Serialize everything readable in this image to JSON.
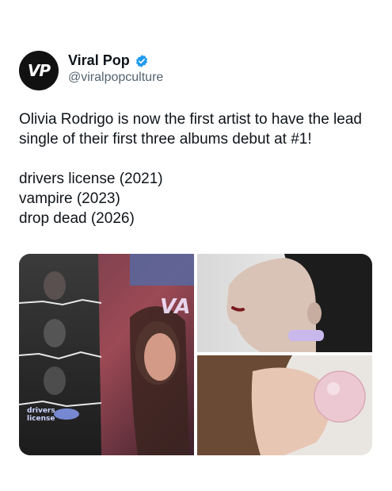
{
  "author": {
    "avatar_text": "VP",
    "display_name": "Viral Pop",
    "handle": "@viralpopculture",
    "verified": true,
    "verified_icon": "verified-badge-icon"
  },
  "post": {
    "line1": "Olivia Rodrigo is now the first artist to have the lead single of their first three albums debut at #1!",
    "list": [
      "drivers license (2021)",
      "vampire (2023)",
      "drop dead (2026)"
    ]
  },
  "media": {
    "cover_text_line1": "drivers",
    "cover_text_line2": "license",
    "vampire_text": "VA",
    "colors": {
      "accent_blue": "#1d9bf0",
      "muted_text": "#536471"
    }
  }
}
